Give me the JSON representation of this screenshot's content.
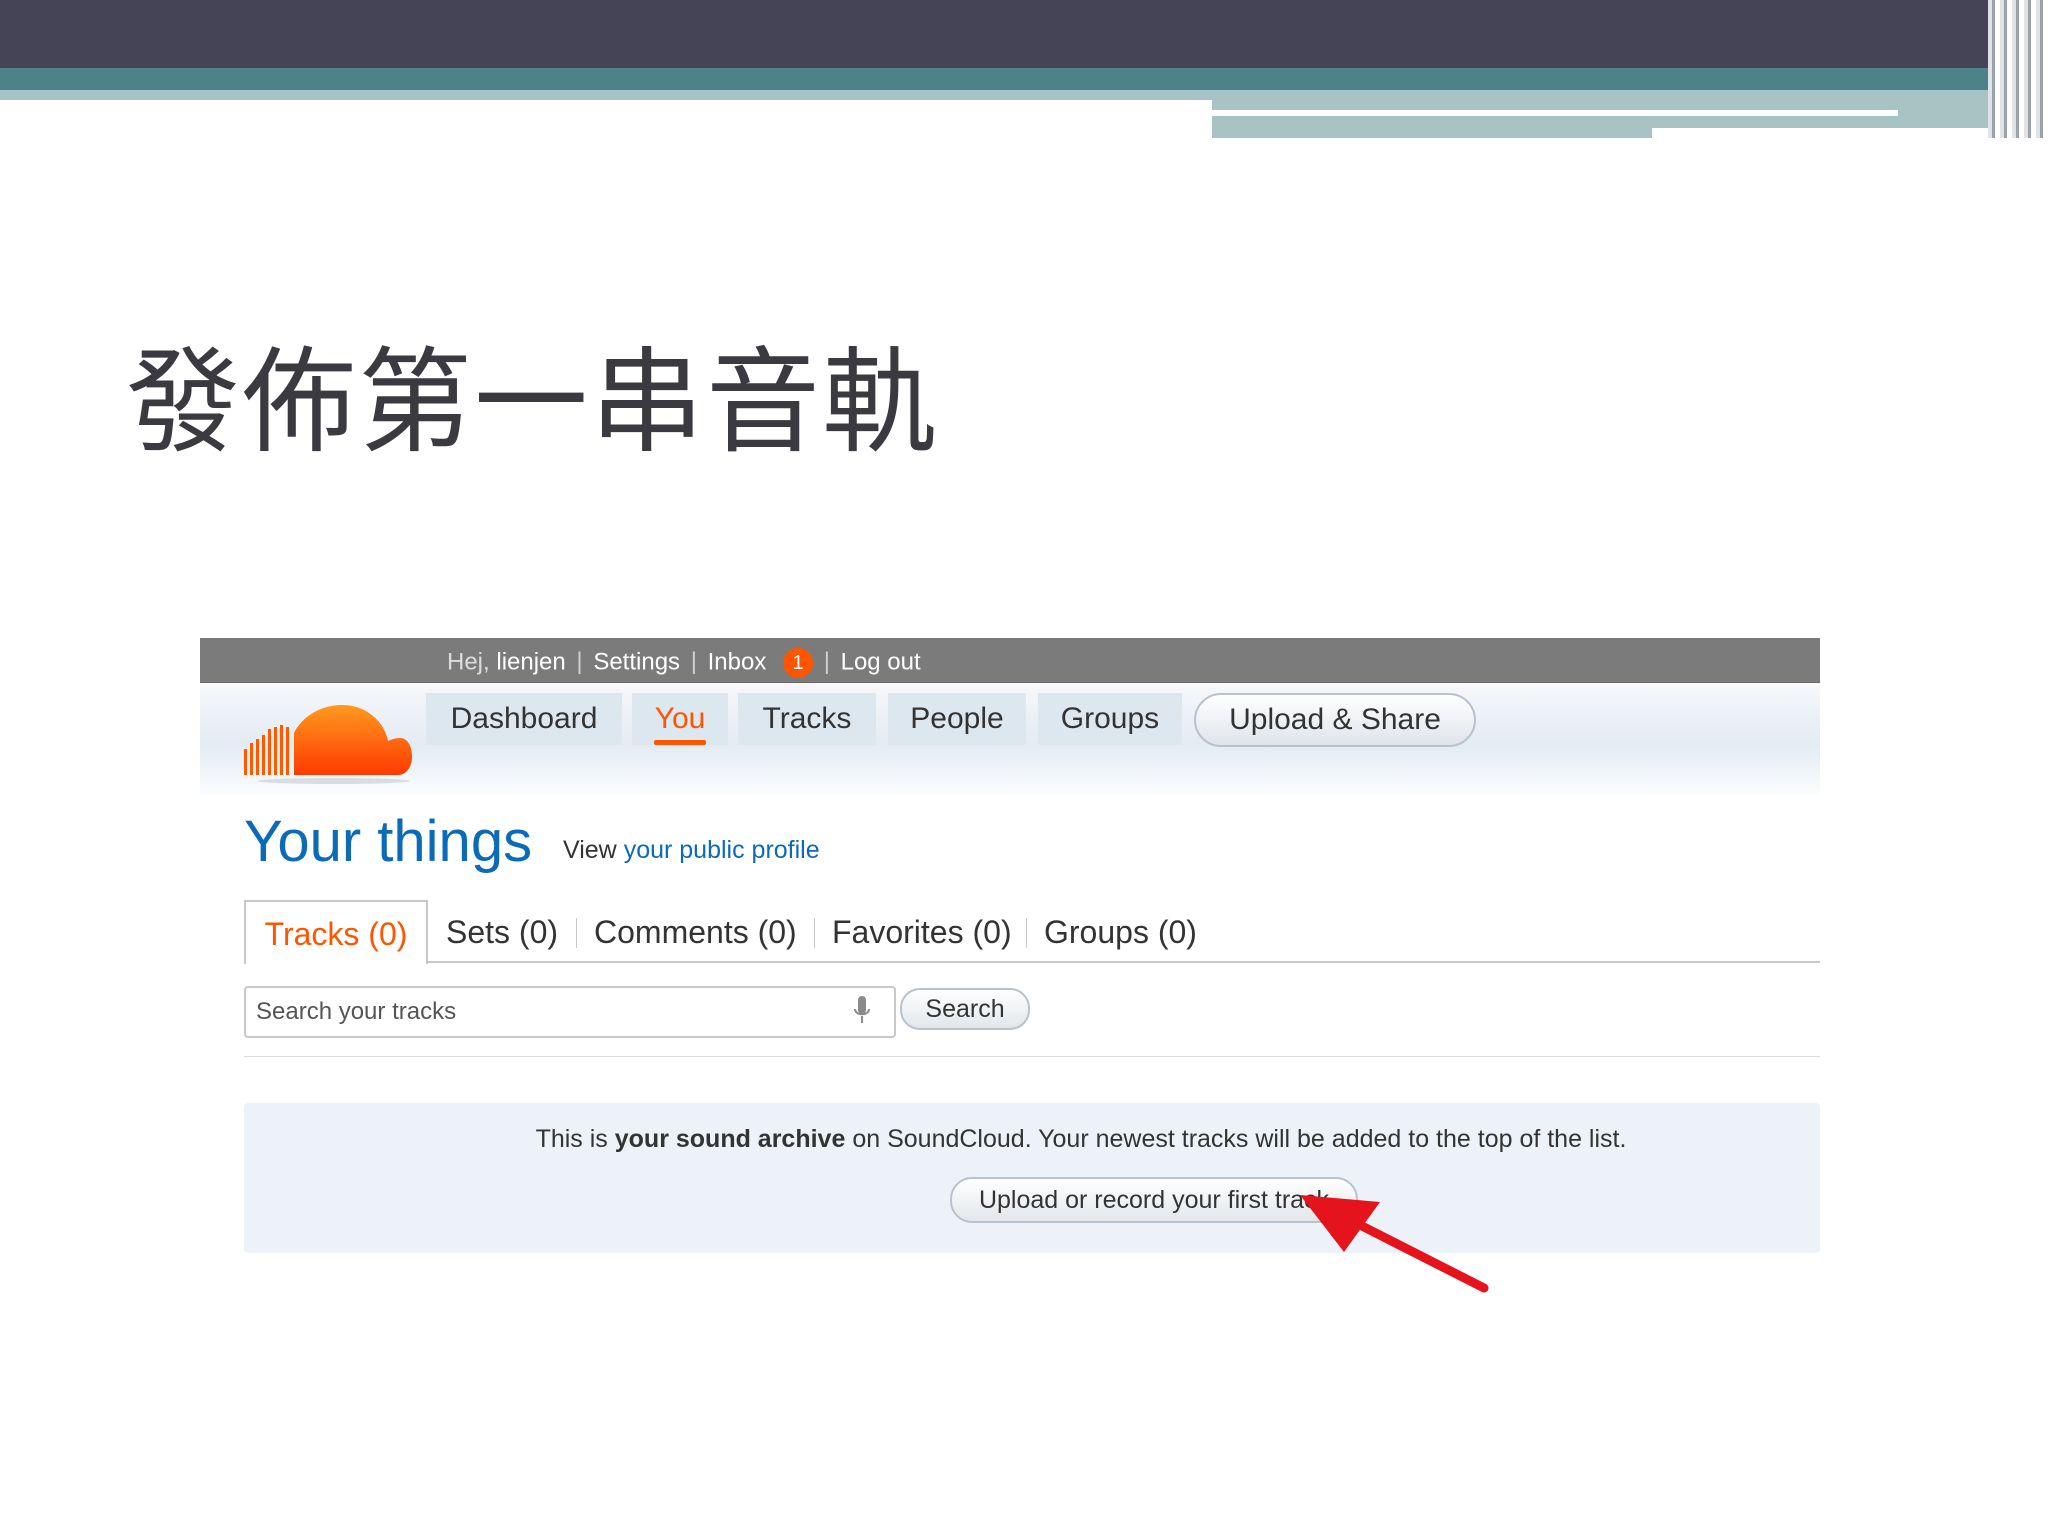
{
  "slide": {
    "title": "發佈第一串音軌"
  },
  "topbar": {
    "greeting": "Hej,",
    "username": "lienjen",
    "sep": "|",
    "settings": "Settings",
    "inbox": "Inbox",
    "inbox_count": "1",
    "logout": "Log out"
  },
  "nav": {
    "items": [
      "Dashboard",
      "You",
      "Tracks",
      "People",
      "Groups"
    ],
    "active": "You",
    "upload_share": "Upload & Share"
  },
  "page": {
    "heading": "Your things",
    "view_prefix": "View",
    "view_link": "your public profile"
  },
  "tabs": [
    "Tracks (0)",
    "Sets (0)",
    "Comments (0)",
    "Favorites (0)",
    "Groups (0)"
  ],
  "search": {
    "placeholder": "Search your tracks",
    "button": "Search"
  },
  "archive": {
    "text1": "This is",
    "bold": "your sound archive",
    "text2": "on SoundCloud. Your newest tracks will be added to the top of the list.",
    "button": "Upload or record your first track"
  },
  "colors": {
    "brand_orange": "#ff5500",
    "link_blue": "#0b6bb8",
    "annotation_arrow": "#e5141c"
  },
  "icons": {
    "logo": "soundcloud-logo",
    "mic": "microphone-icon",
    "annotation": "red-arrow-icon"
  }
}
